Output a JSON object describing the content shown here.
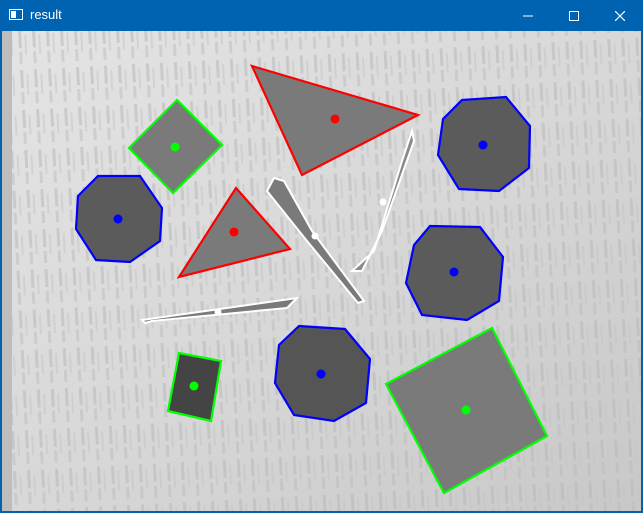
{
  "window": {
    "title": "result",
    "app_icon": "opencv-window-icon",
    "controls": [
      "minimize-icon",
      "maximize-icon",
      "close-icon"
    ]
  },
  "colors": {
    "titlebar": "#0063b1",
    "title_text": "#ffffff",
    "triangle_outline": "#ff0000",
    "rectangle_outline": "#00ff00",
    "coin_outline": "#0000ff",
    "arrow_outline": "#ffffff",
    "shape_fill": "#7a7a7a",
    "coin_fill": "#5b5b5b",
    "background_paper": "#d9d9d9"
  },
  "detections": {
    "triangles": 2,
    "rectangles": 3,
    "coins": 4,
    "arrows": 3
  }
}
